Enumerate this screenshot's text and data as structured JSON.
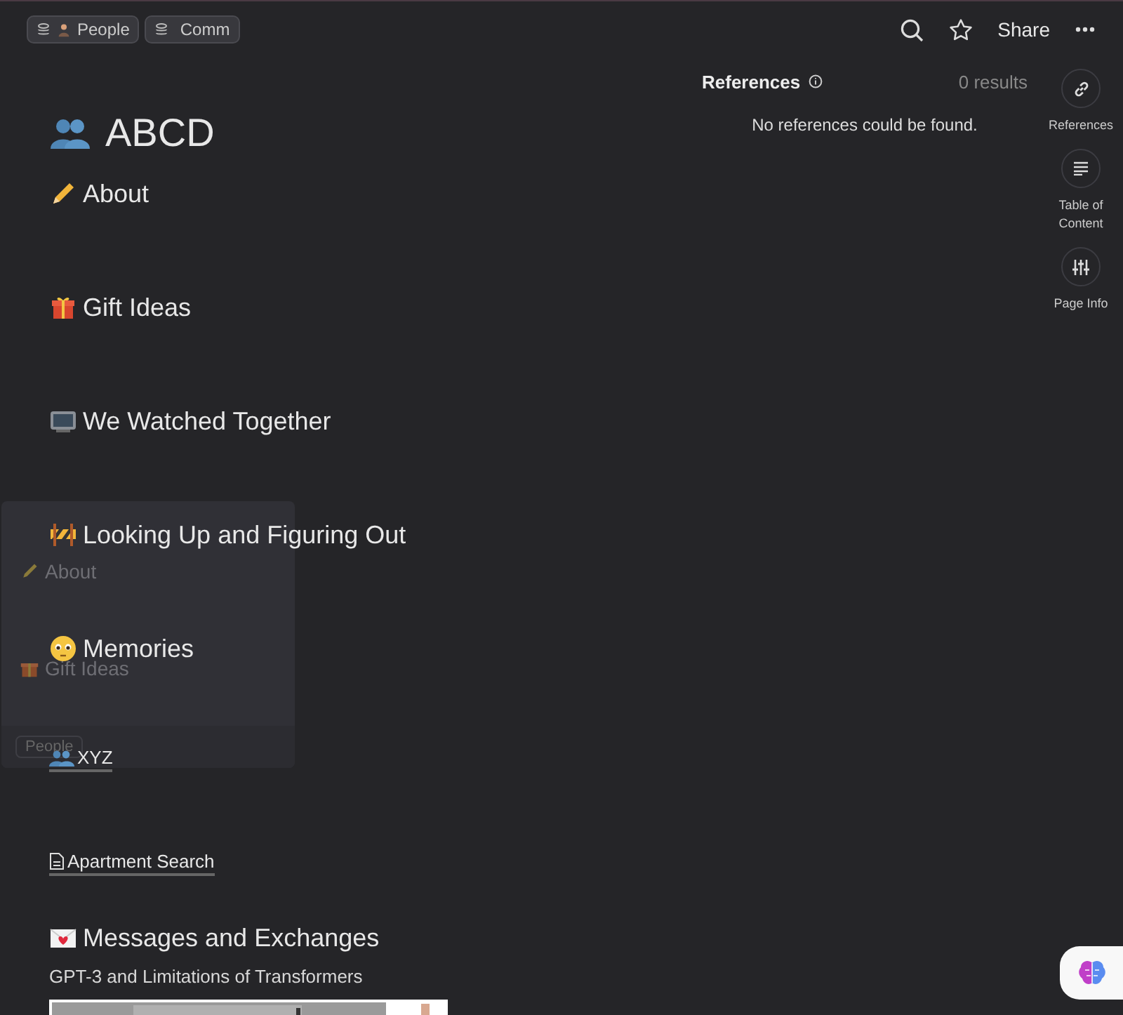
{
  "breadcrumbs": [
    {
      "label": "People"
    },
    {
      "label": "Comm"
    }
  ],
  "toolbar": {
    "share": "Share"
  },
  "page": {
    "title": "ABCD",
    "blocks": [
      {
        "kind": "heading",
        "text": "About"
      },
      {
        "kind": "heading",
        "text": "Gift Ideas"
      },
      {
        "kind": "heading",
        "text": "We Watched Together"
      },
      {
        "kind": "heading",
        "text": "Looking Up and Figuring Out"
      },
      {
        "kind": "heading",
        "text": "Memories"
      },
      {
        "kind": "link",
        "text": "XYZ"
      },
      {
        "kind": "link",
        "text": "Apartment Search"
      },
      {
        "kind": "heading",
        "text": "Messages and Exchanges"
      },
      {
        "kind": "text",
        "text": "GPT-3 and Limitations of Transformers"
      },
      {
        "kind": "picture"
      }
    ]
  },
  "preview_card": {
    "items": [
      {
        "text": "About"
      },
      {
        "text": "Gift Ideas"
      }
    ],
    "tag": "People"
  },
  "references": {
    "title": "References",
    "count": "0 results",
    "empty": "No references could be found."
  },
  "rail": [
    {
      "label": "References"
    },
    {
      "label": "Table of Content"
    },
    {
      "label": "Page Info"
    }
  ]
}
